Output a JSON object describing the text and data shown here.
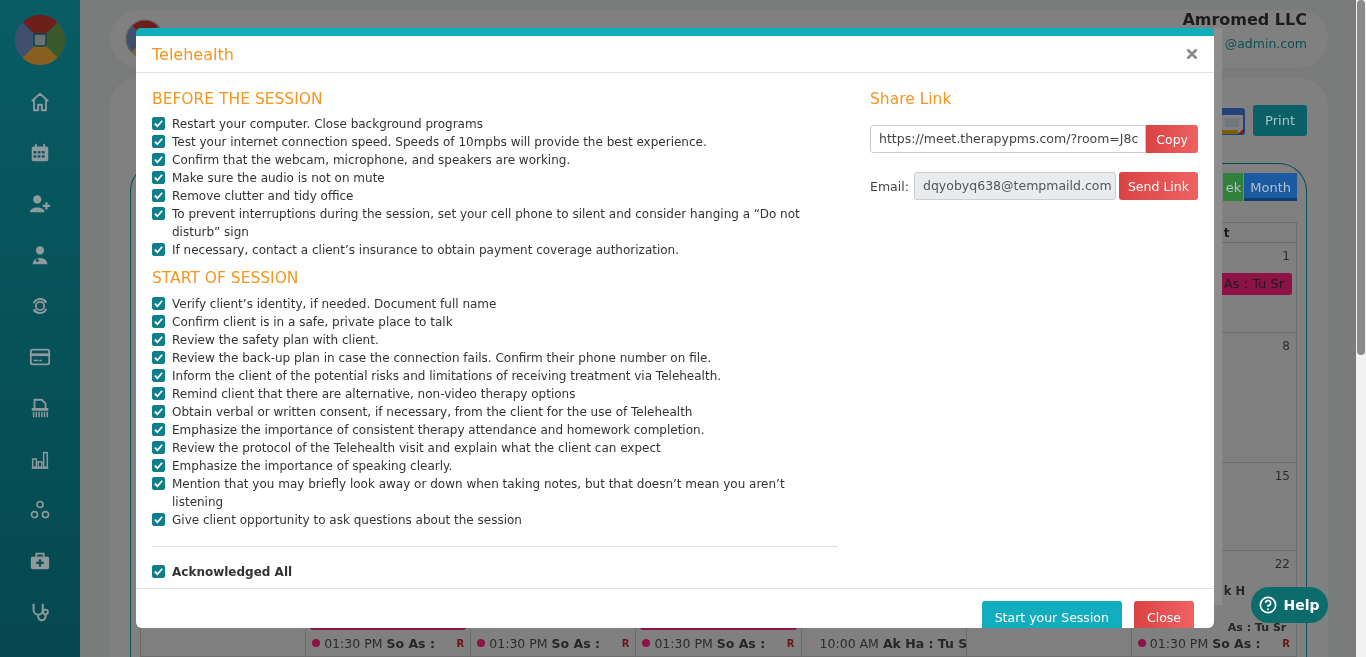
{
  "header": {
    "company": "Amromed LLC",
    "email": "@admin.com"
  },
  "page": {
    "print_button": "Print"
  },
  "calendar": {
    "view_buttons": [
      {
        "label": "ek",
        "selected": false,
        "color": "#31803b"
      },
      {
        "label": "Month",
        "selected": true,
        "color": "#1b5aa0"
      }
    ],
    "weekday": "t",
    "weeks": [
      {
        "cells": [
          {},
          {},
          {},
          {},
          {},
          {},
          {
            "date": "1",
            "events": [
              {
                "kind": "bar",
                "title": "As : Tu Sr",
                "color": "#8d1245"
              }
            ]
          }
        ]
      },
      {
        "cells": [
          {},
          {},
          {},
          {},
          {},
          {},
          {
            "date": "8"
          }
        ]
      },
      {
        "cells": [
          {},
          {},
          {},
          {},
          {},
          {},
          {
            "date": "15"
          }
        ]
      },
      {
        "cells": [
          {},
          {
            "events": [
              {
                "kind": "bar",
                "color": "#8d1245"
              },
              {
                "kind": "dot",
                "time": "01:30 PM",
                "title": "So As :",
                "code": "R",
                "color": "#8d1245"
              }
            ]
          },
          {
            "events": [
              {
                "kind": "dot",
                "time": "01:30 PM",
                "title": "So As :",
                "code": "R",
                "color": "#8d1245"
              }
            ]
          },
          {
            "events": [
              {
                "kind": "bar",
                "color": "#8d1245"
              },
              {
                "kind": "dot",
                "time": "01:30 PM",
                "title": "So As :",
                "code": "R",
                "color": "#8d1245"
              }
            ]
          },
          {
            "events": [
              {
                "kind": "dot",
                "time": "10:00 AM",
                "title": "Ak Ha : Tu S",
                "color": "#8a7d82"
              }
            ]
          },
          {},
          {
            "date": "22",
            "events": [
              {
                "kind": "line",
                "title": "k H"
              },
              {
                "kind": "line",
                "title": "As : Tu Sr"
              },
              {
                "kind": "dot",
                "time": "01:30 PM",
                "title": "So As :",
                "code": "R",
                "color": "#8d1245"
              }
            ]
          }
        ]
      }
    ]
  },
  "modal": {
    "title": "Telehealth",
    "sections": [
      {
        "heading": "BEFORE THE SESSION",
        "items": [
          {
            "text": "Restart your computer. Close background programs",
            "checked": true
          },
          {
            "text": "Test your internet connection speed. Speeds of 10mpbs will provide the best experience.",
            "checked": true
          },
          {
            "text": "Confirm that the webcam, microphone, and speakers are working.",
            "checked": true
          },
          {
            "text": "Make sure the audio is not on mute",
            "checked": true
          },
          {
            "text": "Remove clutter and tidy office",
            "checked": true
          },
          {
            "text": "To prevent interruptions during the session, set your cell phone to silent and consider hanging a “Do not disturb” sign",
            "checked": true
          },
          {
            "text": "If necessary, contact a client’s insurance to obtain payment coverage authorization.",
            "checked": true
          }
        ]
      },
      {
        "heading": "START OF SESSION",
        "items": [
          {
            "text": "Verify client’s identity, if needed. Document full name",
            "checked": true
          },
          {
            "text": "Confirm client is in a safe, private place to talk",
            "checked": true
          },
          {
            "text": "Review the safety plan with client.",
            "checked": true
          },
          {
            "text": "Review the back-up plan in case the connection fails. Confirm their phone number on file.",
            "checked": true
          },
          {
            "text": "Inform the client of the potential risks and limitations of receiving treatment via Telehealth.",
            "checked": true
          },
          {
            "text": "Remind client that there are alternative, non-video therapy options",
            "checked": true
          },
          {
            "text": "Obtain verbal or written consent, if necessary, from the client for the use of Telehealth",
            "checked": true
          },
          {
            "text": "Emphasize the importance of consistent therapy attendance and homework completion.",
            "checked": true
          },
          {
            "text": "Review the protocol of the Telehealth visit and explain what the client can expect",
            "checked": true
          },
          {
            "text": "Emphasize the importance of speaking clearly.",
            "checked": true
          },
          {
            "text": "Mention that you may briefly look away or down when taking notes, but that doesn’t mean you aren’t listening",
            "checked": true
          },
          {
            "text": "Give client opportunity to ask questions about the session",
            "checked": true
          }
        ]
      }
    ],
    "acknowledge": {
      "label": "Acknowledged All",
      "checked": true
    },
    "share": {
      "heading": "Share Link",
      "link": "https://meet.therapypms.com/?room=J8c",
      "copy_button": "Copy",
      "email_label": "Email:",
      "email": "dqyobyq638@tempmaild.com",
      "send_button": "Send Link"
    },
    "footer_buttons": [
      {
        "label": "Start your Session",
        "kind": "primary"
      },
      {
        "label": "Close",
        "kind": "danger"
      }
    ]
  },
  "help_button": "Help"
}
